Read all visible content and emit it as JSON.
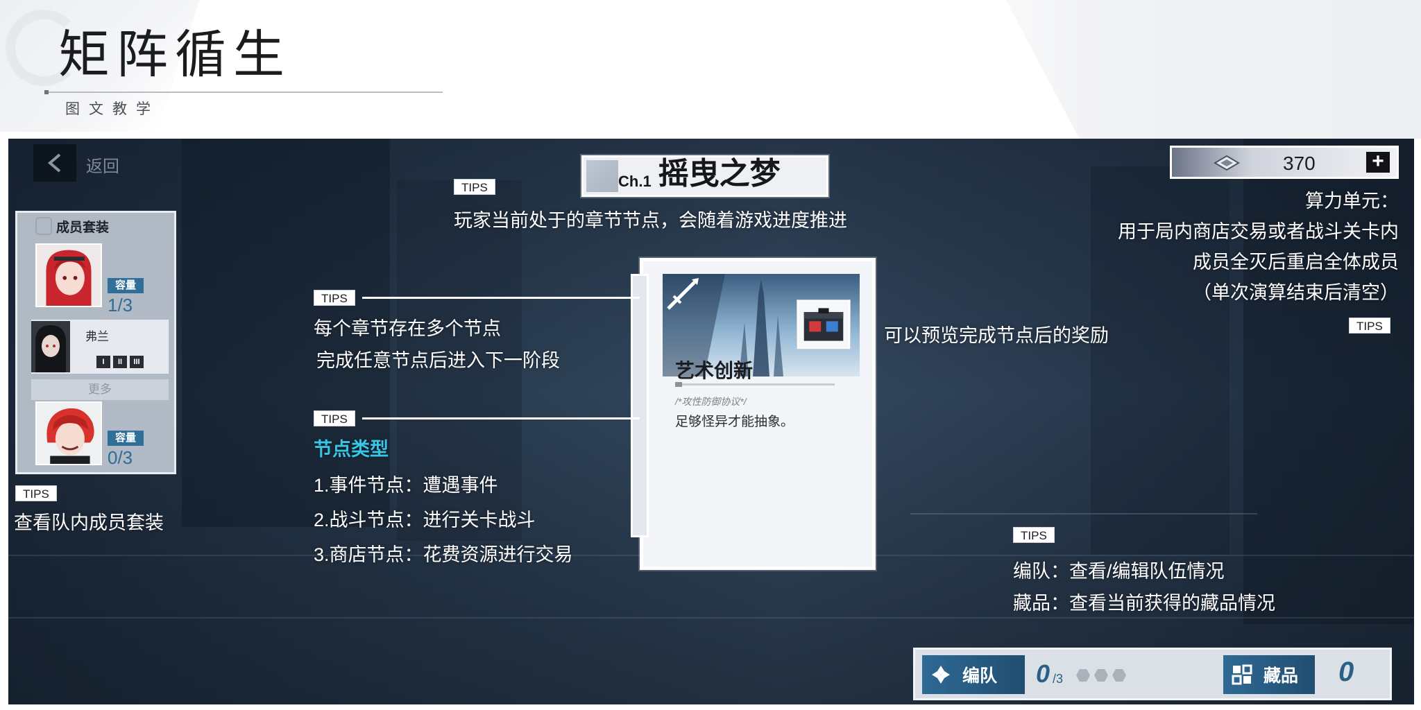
{
  "header": {
    "title": "矩阵循生",
    "subtitle": "图文教学"
  },
  "game": {
    "back_label": "返回",
    "chapter": {
      "number": "Ch.1",
      "name": "摇曳之梦"
    },
    "compute_units": {
      "value": "370",
      "plus_label": "+"
    },
    "member_panel": {
      "title": "成员套装",
      "capacity_label_1": "容量",
      "capacity_value_1": "1/3",
      "member_name": "弗兰",
      "marks": [
        "I",
        "II",
        "III"
      ],
      "more_label": "更多",
      "capacity_label_2": "容量",
      "capacity_value_2": "0/3"
    },
    "node_card": {
      "title": "艺术创新",
      "tag": "/*攻性防御协议*/",
      "description": "足够怪异才能抽象。"
    },
    "bottom_bar": {
      "team_label": "编队",
      "team_count": "0",
      "team_max": "/3",
      "collection_label": "藏品",
      "collection_count": "0"
    }
  },
  "tips": {
    "tag_label": "TIPS",
    "chapter": "玩家当前处于的章节节点，会随着游戏进度推进",
    "nodes_line1": "每个章节存在多个节点",
    "nodes_line2": "完成任意节点后进入下一阶段",
    "node_types_heading": "节点类型",
    "node_type_1": "1.事件节点：遭遇事件",
    "node_type_2": "2.战斗节点：进行关卡战斗",
    "node_type_3": "3.商店节点：花费资源进行交易",
    "reward_preview": "可以预览完成节点后的奖励",
    "member_set": "查看队内成员套装",
    "compute_line1": "算力单元：",
    "compute_line2": "用于局内商店交易或者战斗关卡内",
    "compute_line3": "成员全灭后重启全体成员",
    "compute_line4": "（单次演算结束后清空）",
    "team_info": "编队：查看/编辑队伍情况",
    "collection_info": "藏品：查看当前获得的藏品情况"
  },
  "colors": {
    "accent_blue": "#2e6a95",
    "tip_cyan": "#37c6e6"
  }
}
